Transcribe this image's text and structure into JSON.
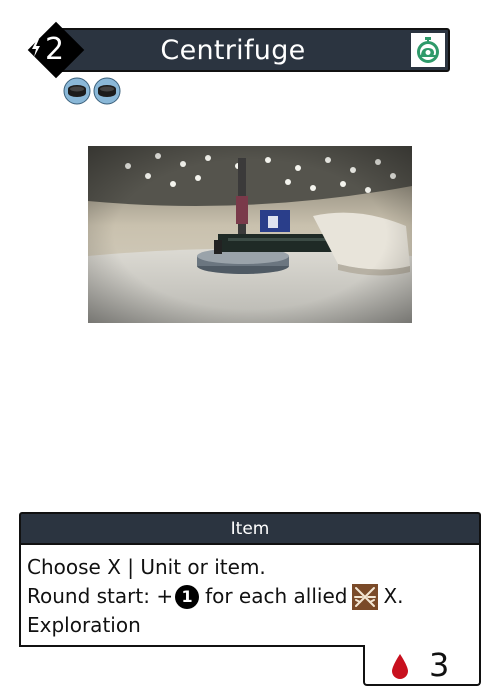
{
  "card": {
    "cost": "2",
    "title": "Centrifuge",
    "type": "Item",
    "rules": {
      "line1": "Choose X | Unit or item.",
      "line2_prefix": "Round start: +",
      "line2_number": "1",
      "line2_middle": "for each allied",
      "line2_suffix": "X.",
      "line3": "Exploration"
    },
    "blood_cost": "3"
  },
  "icons": {
    "cost": "lightning-bolt-icon",
    "speed": "stopwatch-snail-icon",
    "tokens": [
      "disc-token-icon",
      "disc-token-icon"
    ],
    "ally": "crossed-weapons-icon",
    "blood": "blood-drop-icon"
  },
  "colors": {
    "header_bg": "#2b3440",
    "speed_icon": "#2e9a6a",
    "token": "#8ab8d8",
    "blood": "#c8101e",
    "ally_icon_bg": "#7a4a28"
  }
}
